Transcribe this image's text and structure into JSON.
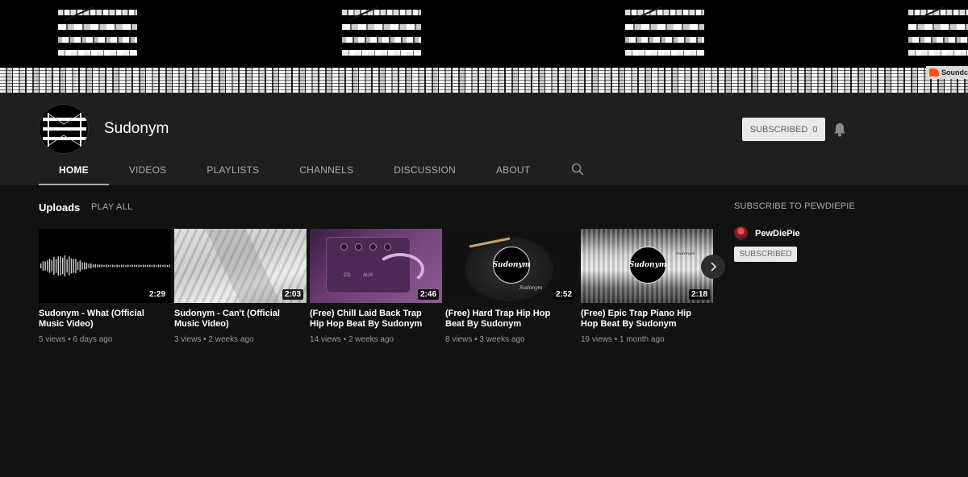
{
  "banner": {
    "soundcloud_label": "Soundc"
  },
  "channel": {
    "name": "Sudonym",
    "subscribe_label": "SUBSCRIBED",
    "subscriber_count": "0"
  },
  "tabs": [
    {
      "label": "HOME",
      "active": true
    },
    {
      "label": "VIDEOS"
    },
    {
      "label": "PLAYLISTS"
    },
    {
      "label": "CHANNELS"
    },
    {
      "label": "DISCUSSION"
    },
    {
      "label": "ABOUT"
    }
  ],
  "section": {
    "title": "Uploads",
    "play_all": "PLAY ALL"
  },
  "videos": [
    {
      "title": "Sudonym - What (Official Music Video)",
      "duration": "2:29",
      "views": "5 views",
      "age": "6 days ago"
    },
    {
      "title": "Sudonym - Can't (Official Music Video)",
      "duration": "2:03",
      "views": "3 views",
      "age": "2 weeks ago"
    },
    {
      "title": "(Free) Chill Laid Back Trap Hip Hop Beat By Sudonym",
      "duration": "2:46",
      "views": "14 views",
      "age": "2 weeks ago",
      "thumb_labels": [
        "CD",
        "AUX"
      ]
    },
    {
      "title": "(Free) Hard Trap Hip Hop Beat By Sudonym",
      "duration": "2:52",
      "views": "8 views",
      "age": "3 weeks ago",
      "logo_text": "Sudonym",
      "small_logo_text": "Sudonym"
    },
    {
      "title": "(Free) Epic Trap Piano Hip Hop Beat By Sudonym",
      "duration": "2:18",
      "views": "19 views",
      "age": "1 month ago",
      "logo_text": "Sudonym",
      "small_logo_text": "Sudonym"
    }
  ],
  "sidebar": {
    "title": "SUBSCRIBE TO PEWDIEPIE",
    "channel_name": "PewDiePie",
    "button_label": "SUBSCRIBED"
  }
}
